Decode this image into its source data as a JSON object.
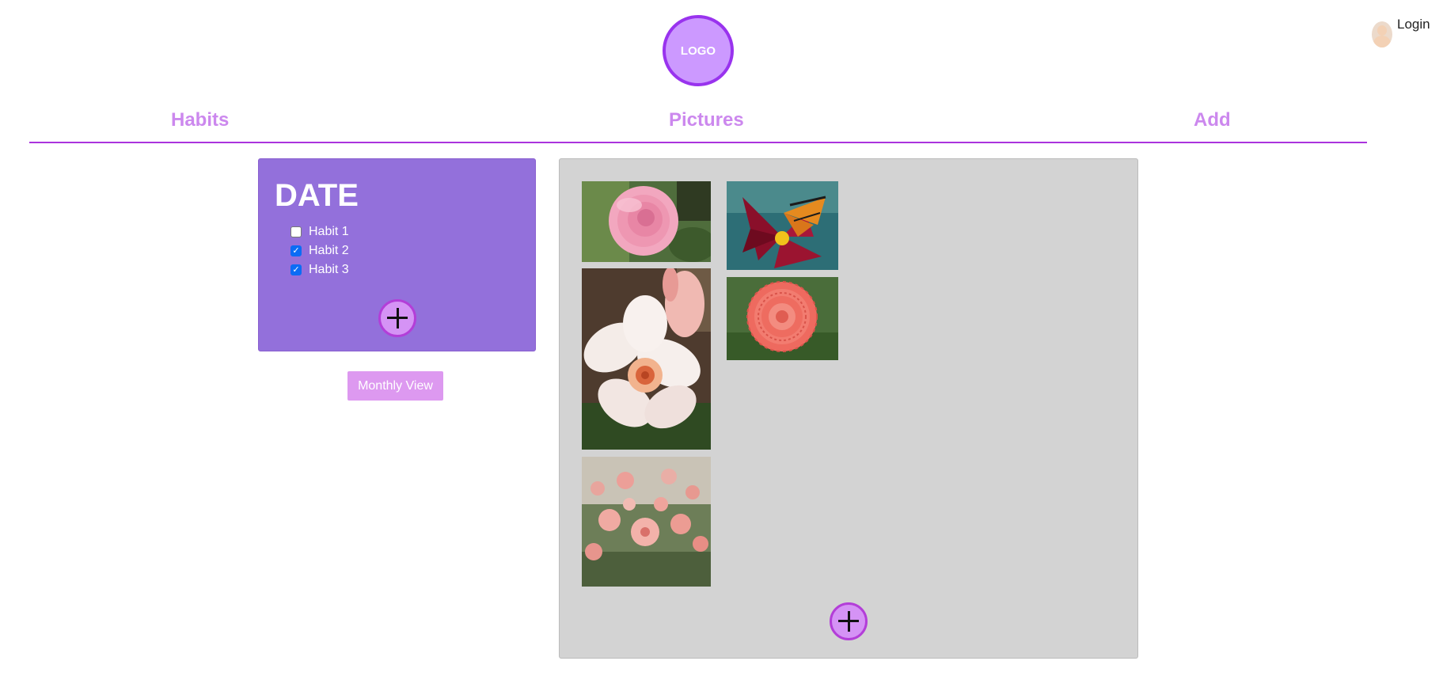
{
  "header": {
    "logo_text": "LOGO",
    "login_label": "Login"
  },
  "nav": {
    "tabs": [
      {
        "label": "Habits"
      },
      {
        "label": "Pictures"
      },
      {
        "label": "Add"
      }
    ]
  },
  "habits_card": {
    "date_heading": "DATE",
    "habits": [
      {
        "label": "Habit 1",
        "checked": false
      },
      {
        "label": "Habit 2",
        "checked": true
      },
      {
        "label": "Habit 3",
        "checked": true
      }
    ]
  },
  "monthly_view_label": "Monthly View",
  "pictures": [
    {
      "icon": "pink-camellia-photo"
    },
    {
      "icon": "red-flower-with-butterfly-photo"
    },
    {
      "icon": "white-plumeria-photo"
    },
    {
      "icon": "pink-dahlia-photo"
    },
    {
      "icon": "dahlia-field-photo"
    }
  ],
  "colors": {
    "accent": "#cc88ee",
    "divider": "#aa33dd",
    "card": "#9370db",
    "button": "#dd99f0",
    "panel": "#d3d3d3"
  }
}
